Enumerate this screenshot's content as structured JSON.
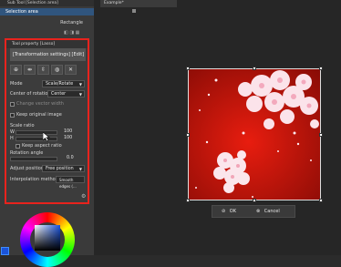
{
  "header": {
    "title": "Sub Tool [Selection area]"
  },
  "canvas_tab": {
    "label": "Example*"
  },
  "subtool": {
    "selected": "Selection area",
    "item2": "Rectangle"
  },
  "tool_property": {
    "title": "Tool property [Lasso]",
    "preview_label": "[Transformation settings] [Edit] [",
    "buttons": [
      "⊕",
      "⇹",
      "⇳",
      "◍",
      "✕"
    ],
    "mode_label": "Mode",
    "mode_value": "Scale/Rotate",
    "center_label": "Center of rotation",
    "center_value": "Center",
    "change_vector_width": "Change vector width",
    "keep_original_image": "Keep original image",
    "scale_ratio_label": "Scale ratio",
    "w_label": "W",
    "w_value": "100",
    "h_label": "H",
    "h_value": "100",
    "keep_aspect_ratio": "Keep aspect ratio",
    "rotation_label": "Rotation angle",
    "rotation_value": "0.0",
    "adjust_position_label": "Adjust position",
    "adjust_position_value": "Free position",
    "interpolation_label": "Interpolation method",
    "interpolation_value": "Smooth edges (..."
  },
  "confirm": {
    "ok": "OK",
    "cancel": "Cancel"
  },
  "colors": {
    "highlight": "#e8231d",
    "art_bg": "#c0150e"
  }
}
